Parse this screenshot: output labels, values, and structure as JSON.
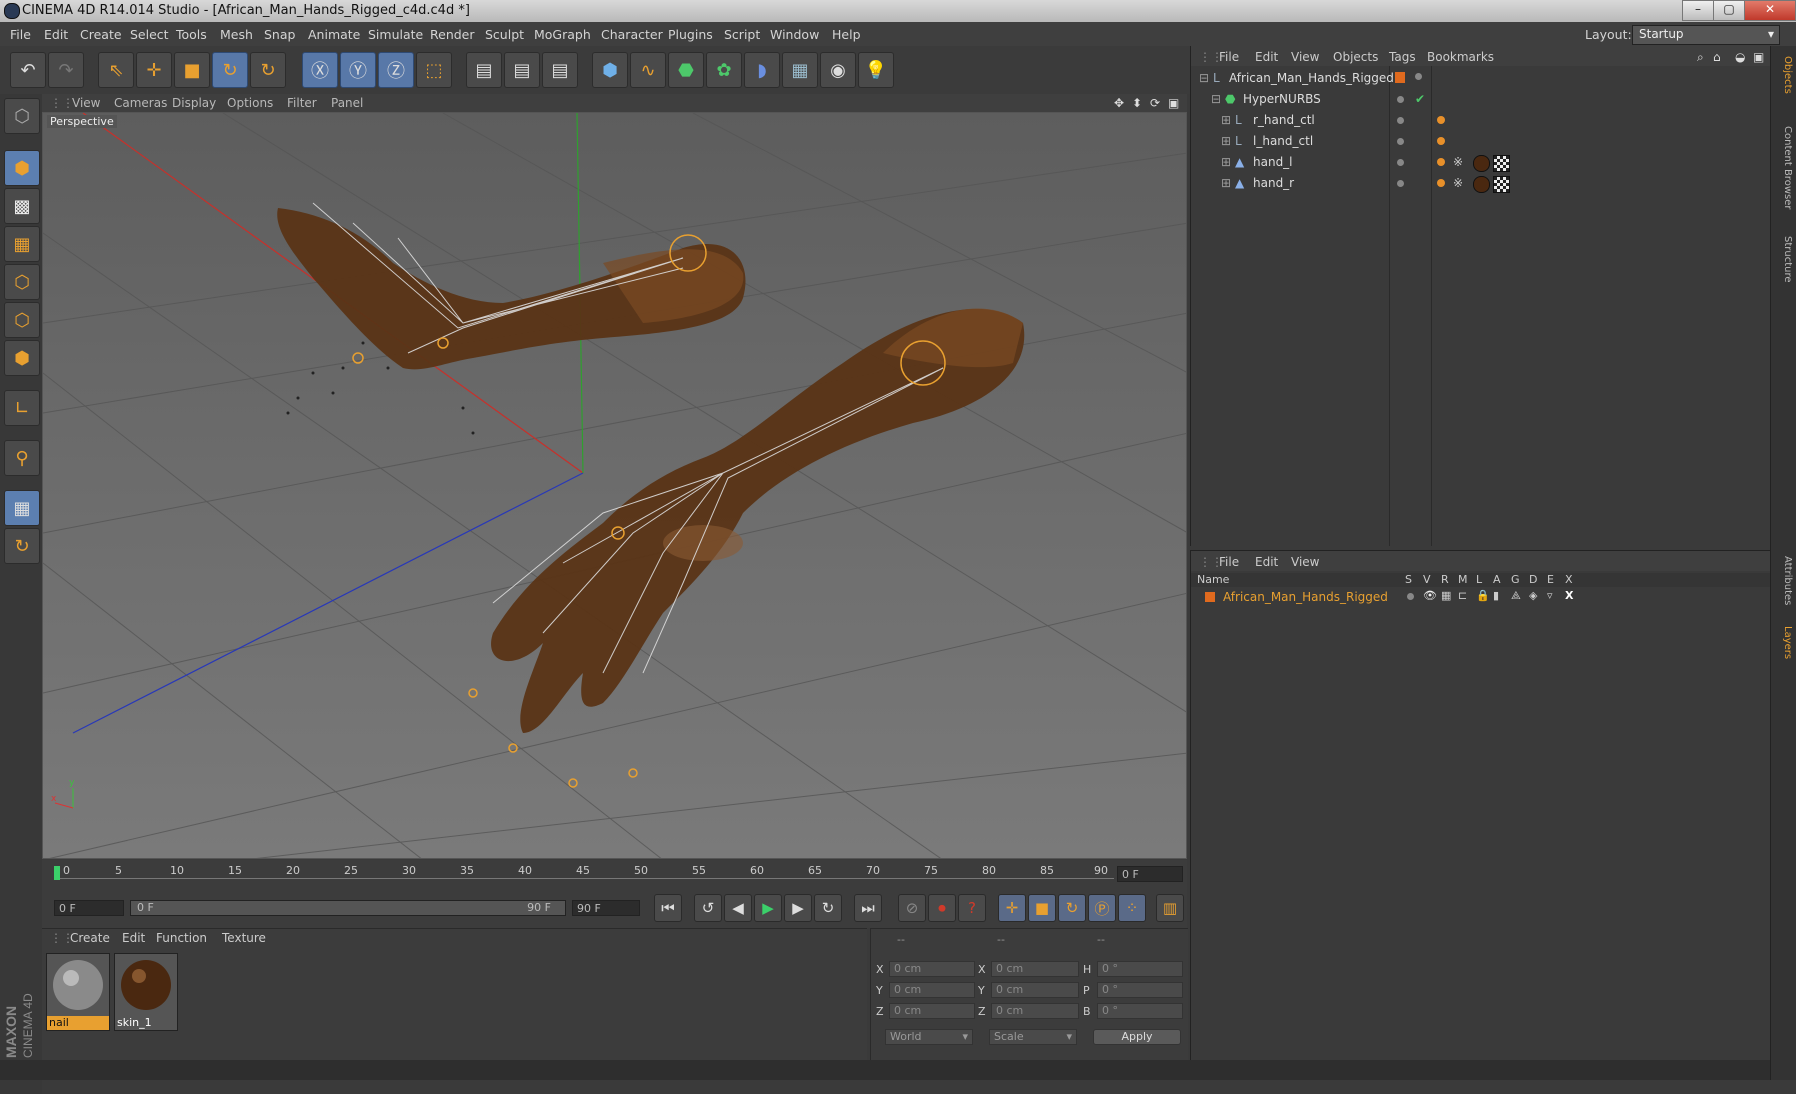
{
  "window": {
    "title": "CINEMA 4D R14.014 Studio - [African_Man_Hands_Rigged_c4d.c4d *]",
    "buttons": [
      "–",
      "▢",
      "✕"
    ]
  },
  "menubar": {
    "items": [
      "File",
      "Edit",
      "Create",
      "Select",
      "Tools",
      "Mesh",
      "Snap",
      "Animate",
      "Simulate",
      "Render",
      "Sculpt",
      "MoGraph",
      "Character",
      "Plugins",
      "Script",
      "Window",
      "Help"
    ],
    "layout_label": "Layout:",
    "layout_value": "Startup"
  },
  "viewport": {
    "menu": [
      "View",
      "Cameras",
      "Display",
      "Options",
      "Filter",
      "Panel"
    ],
    "label": "Perspective"
  },
  "timeline": {
    "ticks": [
      "0",
      "5",
      "10",
      "15",
      "20",
      "25",
      "30",
      "35",
      "40",
      "45",
      "50",
      "55",
      "60",
      "65",
      "70",
      "75",
      "80",
      "85",
      "90"
    ],
    "current_frame": "0 F",
    "start_field": "0 F",
    "range_start": "0 F",
    "range_end": "90 F",
    "end_field": "90 F"
  },
  "material_manager": {
    "menu": [
      "Create",
      "Edit",
      "Function",
      "Texture"
    ],
    "materials": [
      {
        "name": "nail",
        "selected": true
      },
      {
        "name": "skin_1",
        "selected": false
      }
    ]
  },
  "coordinates": {
    "headers": [
      "--",
      "--",
      "--"
    ],
    "rows": [
      {
        "a": "X",
        "av": "0 cm",
        "b": "X",
        "bv": "0 cm",
        "c": "H",
        "cv": "0 °"
      },
      {
        "a": "Y",
        "av": "0 cm",
        "b": "Y",
        "bv": "0 cm",
        "c": "P",
        "cv": "0 °"
      },
      {
        "a": "Z",
        "av": "0 cm",
        "b": "Z",
        "bv": "0 cm",
        "c": "B",
        "cv": "0 °"
      }
    ],
    "space": "World",
    "mode": "Scale",
    "apply": "Apply"
  },
  "object_manager": {
    "menu": [
      "File",
      "Edit",
      "View",
      "Objects",
      "Tags",
      "Bookmarks"
    ],
    "objects": [
      {
        "name": "African_Man_Hands_Rigged"
      },
      {
        "name": "HyperNURBS"
      },
      {
        "name": "r_hand_ctl"
      },
      {
        "name": "l_hand_ctl"
      },
      {
        "name": "hand_l"
      },
      {
        "name": "hand_r"
      }
    ]
  },
  "layer_manager": {
    "menu": [
      "File",
      "Edit",
      "View"
    ],
    "columns": [
      "Name",
      "S",
      "V",
      "R",
      "M",
      "L",
      "A",
      "G",
      "D",
      "E",
      "X"
    ],
    "layers": [
      {
        "name": "African_Man_Hands_Rigged",
        "color": "#e06a1e"
      }
    ]
  },
  "side_tabs": [
    "Objects",
    "Content Browser",
    "Structure",
    "Attributes",
    "Layers"
  ],
  "brand": {
    "line1": "MAXON",
    "line2": "CINEMA 4D"
  }
}
